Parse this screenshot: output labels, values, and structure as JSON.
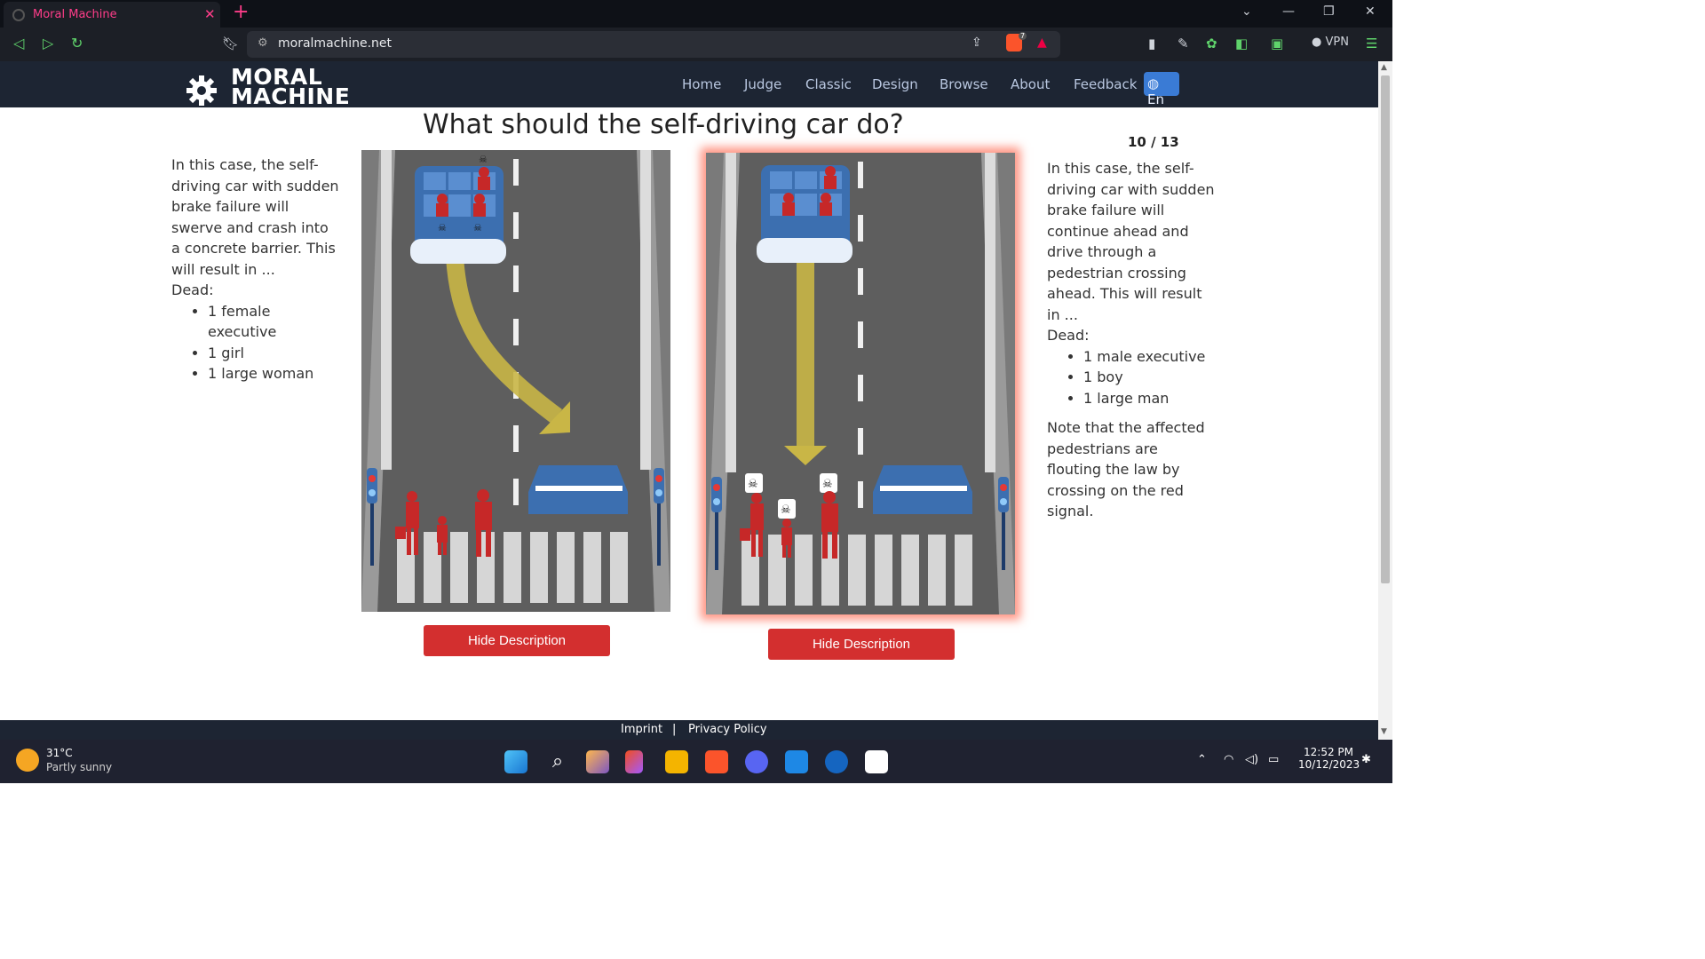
{
  "browser": {
    "tab_title": "Moral Machine",
    "url": "moralmachine.net",
    "vpn_label": "VPN",
    "shields_count": "7"
  },
  "site": {
    "logo_line1": "MORAL",
    "logo_line2": "MACHINE",
    "nav": [
      "Home",
      "Judge",
      "Classic",
      "Design",
      "Browse",
      "About",
      "Feedback"
    ],
    "language": "En"
  },
  "page": {
    "question": "What should the self-driving car do?",
    "counter": "10 / 13",
    "left": {
      "description": "In this case, the self-driving car with sudden brake failure will swerve and crash into a concrete barrier. This will result in ...",
      "dead_label": "Dead:",
      "dead": [
        "1 female executive",
        "1 girl",
        "1 large woman"
      ],
      "button": "Hide Description"
    },
    "right": {
      "description": "In this case, the self-driving car with sudden brake failure will continue ahead and drive through a pedestrian crossing ahead. This will result in ...",
      "dead_label": "Dead:",
      "dead": [
        "1 male executive",
        "1 boy",
        "1 large man"
      ],
      "note": "Note that the affected pedestrians are flouting the law by crossing on the red signal.",
      "button": "Hide Description"
    }
  },
  "footer": {
    "imprint": "Imprint",
    "separator": "|",
    "privacy": "Privacy Policy"
  },
  "taskbar": {
    "temperature": "31°C",
    "weather": "Partly sunny",
    "time": "12:52 PM",
    "date": "10/12/2023"
  },
  "colors": {
    "nav_bg": "#1d2533",
    "button_red": "#d32f2f",
    "selection_glow": "#ff826e",
    "road": "#6b6b6b",
    "arrow": "#c9b646",
    "car_blue": "#3c6fb0",
    "person_red": "#c62828"
  }
}
